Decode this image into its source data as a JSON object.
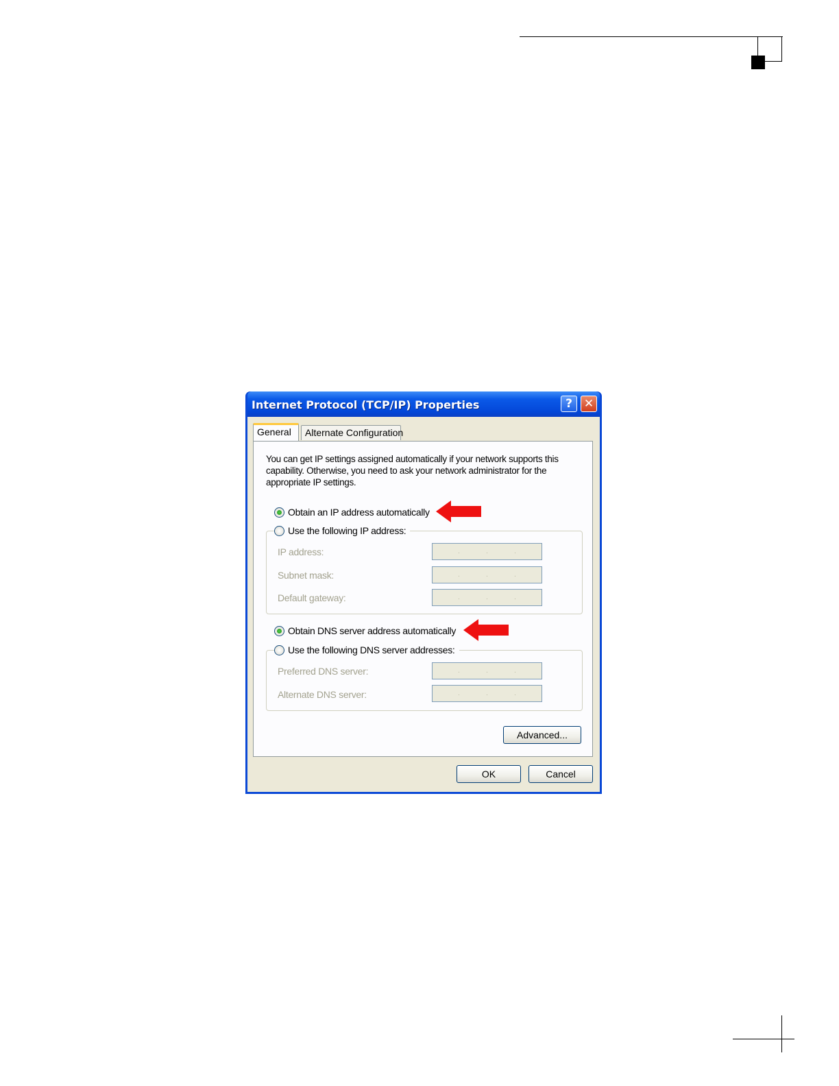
{
  "dialog": {
    "title": "Internet Protocol (TCP/IP) Properties",
    "help_label": "?",
    "close_label": "✕"
  },
  "tabs": [
    {
      "label": "General",
      "active": true
    },
    {
      "label": "Alternate Configuration",
      "active": false
    }
  ],
  "general": {
    "description": "You can get IP settings assigned automatically if your network supports this capability. Otherwise, you need to ask your network administrator for the appropriate IP settings.",
    "ip_mode": {
      "auto_label": "Obtain an IP address automatically",
      "auto_selected": true,
      "manual_label": "Use the following IP address:",
      "manual_selected": false
    },
    "ip_fields": [
      {
        "label": "IP address:",
        "value": ". . ."
      },
      {
        "label": "Subnet mask:",
        "value": ". . ."
      },
      {
        "label": "Default gateway:",
        "value": ". . ."
      }
    ],
    "dns_mode": {
      "auto_label": "Obtain DNS server address automatically",
      "auto_selected": true,
      "manual_label": "Use the following DNS server addresses:",
      "manual_selected": false
    },
    "dns_fields": [
      {
        "label": "Preferred DNS server:",
        "value": ". . ."
      },
      {
        "label": "Alternate DNS server:",
        "value": ". . ."
      }
    ],
    "advanced_label": "Advanced..."
  },
  "footer": {
    "ok_label": "OK",
    "cancel_label": "Cancel"
  },
  "annotations": {
    "arrow_color": "#ee1111"
  }
}
